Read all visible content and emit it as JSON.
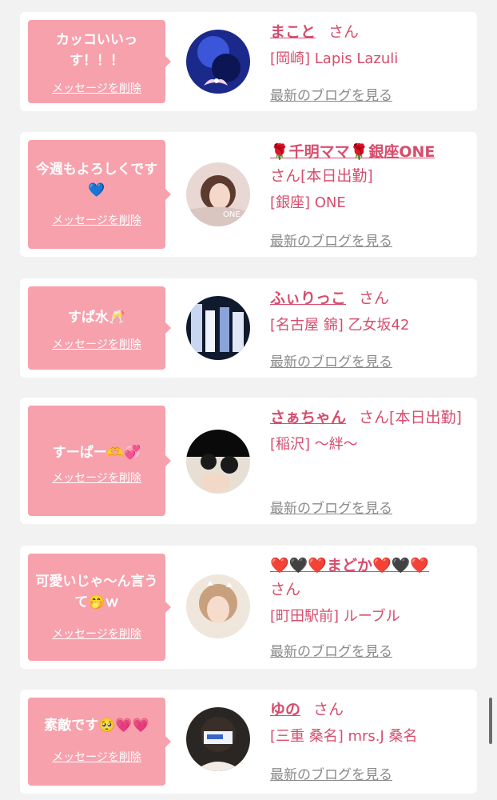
{
  "delete_label": "メッセージを削除",
  "blog_label": "最新のブログを見る",
  "san": "さん",
  "colors": {
    "accent_pink": "#f7a1ad",
    "text_pink": "#d64d6d",
    "link_gray": "#8a8a8a",
    "background": "#f2f2f2"
  },
  "items": [
    {
      "message": "カッコいいっす！！！",
      "name": "まこと",
      "tail": "",
      "place": "[岡崎] Lapis Lazuli"
    },
    {
      "message": "今週もよろしくです💙",
      "name": "🌹千明ママ🌹銀座ONE",
      "tail": "[本日出勤]",
      "place": "[銀座] ONE"
    },
    {
      "message": "すぱ水🥂",
      "name": "ふぃりっこ",
      "tail": "",
      "place": "[名古屋 錦] 乙女坂42"
    },
    {
      "message": "すーぱー🫶💞",
      "name": "さぁちゃん",
      "tail": "[本日出勤]",
      "place": "[稲沢] 〜絆〜"
    },
    {
      "message": "可愛いじゃ〜ん言うて🤭ｗ",
      "name": "❤️🖤❤️まどか❤️🖤❤️",
      "tail": "",
      "place": "[町田駅前] ルーブル"
    },
    {
      "message": "素敵です🥺💗💗",
      "name": "ゆの",
      "tail": "",
      "place": "[三重 桑名] mrs.J 桑名"
    }
  ]
}
